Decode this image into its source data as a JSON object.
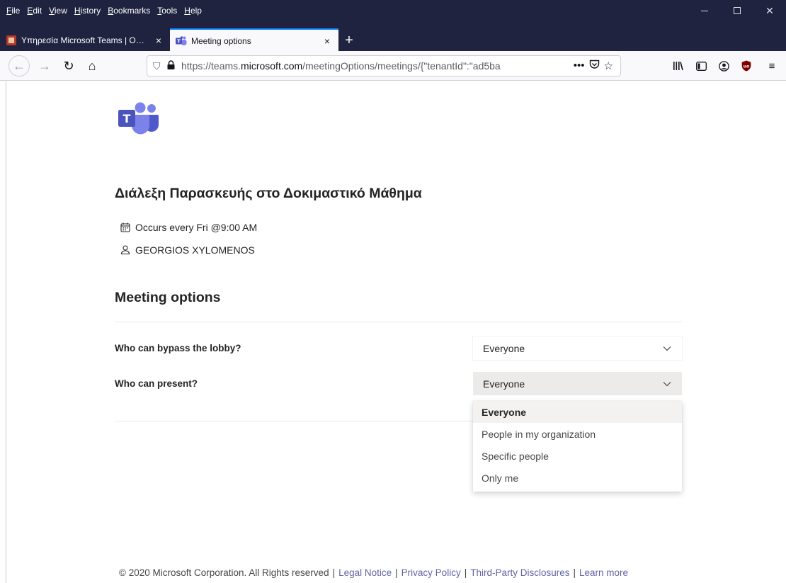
{
  "browser": {
    "menu": [
      "File",
      "Edit",
      "View",
      "History",
      "Bookmarks",
      "Tools",
      "Help"
    ],
    "tabs": [
      {
        "title": "Υπηρεσία Microsoft Teams | O…",
        "close": "×"
      },
      {
        "title": "Meeting options",
        "close": "×"
      }
    ],
    "new_tab": "+",
    "url_prefix": "https://teams.",
    "url_domain": "microsoft.com",
    "url_rest": "/meetingOptions/meetings/{\"tenantId\":\"ad5ba",
    "url_more": "•••"
  },
  "meeting": {
    "title": "Διάλεξη Παρασκευής στο Δοκιμαστικό Μάθημα",
    "recurrence": "Occurs every Fri @9:00 AM",
    "organizer": "GEORGIOS XYLOMENOS"
  },
  "options": {
    "heading": "Meeting options",
    "bypass_lobby": {
      "label": "Who can bypass the lobby?",
      "value": "Everyone"
    },
    "present": {
      "label": "Who can present?",
      "value": "Everyone"
    },
    "present_options": [
      "Everyone",
      "People in my organization",
      "Specific people",
      "Only me"
    ],
    "present_selected_index": 0
  },
  "footer": {
    "copyright": "© 2020 Microsoft Corporation. All Rights reserved",
    "separator": "|",
    "links": [
      "Legal Notice",
      "Privacy Policy",
      "Third-Party Disclosures",
      "Learn more"
    ]
  },
  "colors": {
    "teams_purple": "#6264a7",
    "chrome_dark": "#202340",
    "accent_blue": "#0a84ff"
  }
}
